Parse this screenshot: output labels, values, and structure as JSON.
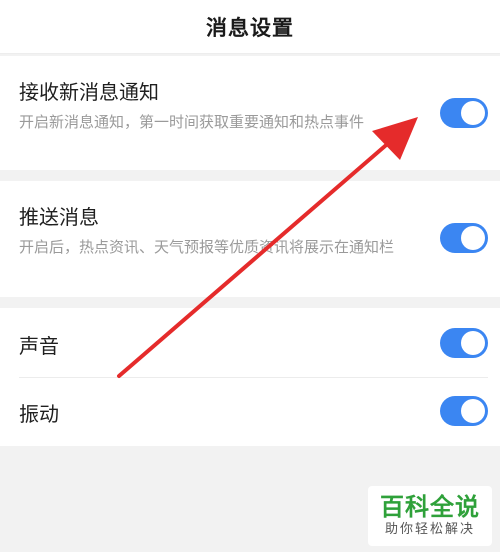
{
  "header": {
    "title": "消息设置"
  },
  "settings": {
    "new_message": {
      "title": "接收新消息通知",
      "description": "开启新消息通知，第一时间获取重要通知和热点事件",
      "enabled": true
    },
    "push": {
      "title": "推送消息",
      "description": "开启后，热点资讯、天气预报等优质资讯将展示在通知栏",
      "enabled": true
    },
    "sound": {
      "title": "声音",
      "enabled": true
    },
    "vibrate": {
      "title": "振动",
      "enabled": true
    }
  },
  "watermark": {
    "main": "百科全说",
    "sub": "助你轻松解决"
  },
  "colors": {
    "accent": "#3b86f2",
    "annotation_arrow": "#e52b2b",
    "watermark_green": "#2fa13a"
  }
}
